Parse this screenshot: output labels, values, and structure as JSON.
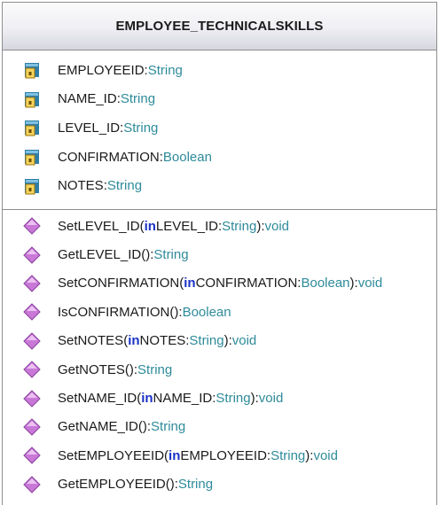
{
  "class_name": "EMPLOYEE_TECHNICALSKILLS",
  "attributes": [
    {
      "name": "EMPLOYEEID",
      "type": "String",
      "icon": "private-attribute-icon"
    },
    {
      "name": "NAME_ID",
      "type": "String",
      "icon": "private-attribute-icon"
    },
    {
      "name": "LEVEL_ID",
      "type": "String",
      "icon": "private-attribute-icon"
    },
    {
      "name": "CONFIRMATION",
      "type": "Boolean",
      "icon": "private-attribute-icon"
    },
    {
      "name": "NOTES",
      "type": "String",
      "icon": "private-attribute-icon"
    }
  ],
  "operations": [
    {
      "name": "SetLEVEL_ID",
      "open": "(",
      "kw": "in",
      "param": "LEVEL_ID",
      "ptype": "String",
      "close": ")",
      "ret": "void",
      "icon": "public-operation-icon"
    },
    {
      "name": "GetLEVEL_ID",
      "open": "()",
      "kw": "",
      "param": "",
      "ptype": "",
      "close": "",
      "ret": "String",
      "icon": "public-operation-icon"
    },
    {
      "name": "SetCONFIRMATION",
      "open": "(",
      "kw": "in",
      "param": "CONFIRMATION",
      "ptype": "Boolean",
      "close": ")",
      "ret": "void",
      "icon": "public-operation-icon"
    },
    {
      "name": "IsCONFIRMATION",
      "open": "()",
      "kw": "",
      "param": "",
      "ptype": "",
      "close": "",
      "ret": "Boolean",
      "icon": "public-operation-icon"
    },
    {
      "name": "SetNOTES",
      "open": "(",
      "kw": "in",
      "param": "NOTES",
      "ptype": "String",
      "close": ")",
      "ret": "void",
      "icon": "public-operation-icon"
    },
    {
      "name": "GetNOTES",
      "open": "()",
      "kw": "",
      "param": "",
      "ptype": "",
      "close": "",
      "ret": "String",
      "icon": "public-operation-icon"
    },
    {
      "name": "SetNAME_ID",
      "open": "(",
      "kw": "in",
      "param": "NAME_ID",
      "ptype": "String",
      "close": ")",
      "ret": "void",
      "icon": "public-operation-icon"
    },
    {
      "name": "GetNAME_ID",
      "open": "()",
      "kw": "",
      "param": "",
      "ptype": "",
      "close": "",
      "ret": "String",
      "icon": "public-operation-icon"
    },
    {
      "name": "SetEMPLOYEEID",
      "open": "(",
      "kw": "in",
      "param": "EMPLOYEEID",
      "ptype": "String",
      "close": ")",
      "ret": "void",
      "icon": "public-operation-icon"
    },
    {
      "name": "GetEMPLOYEEID",
      "open": "()",
      "kw": "",
      "param": "",
      "ptype": "",
      "close": "",
      "ret": "String",
      "icon": "public-operation-icon"
    }
  ],
  "colors": {
    "type": "#2e8b9a",
    "keyword": "#1a32c8",
    "operation_icon": "#c978d8",
    "attribute_icon": "#2f7ea6",
    "lock": "#d4a21c"
  }
}
